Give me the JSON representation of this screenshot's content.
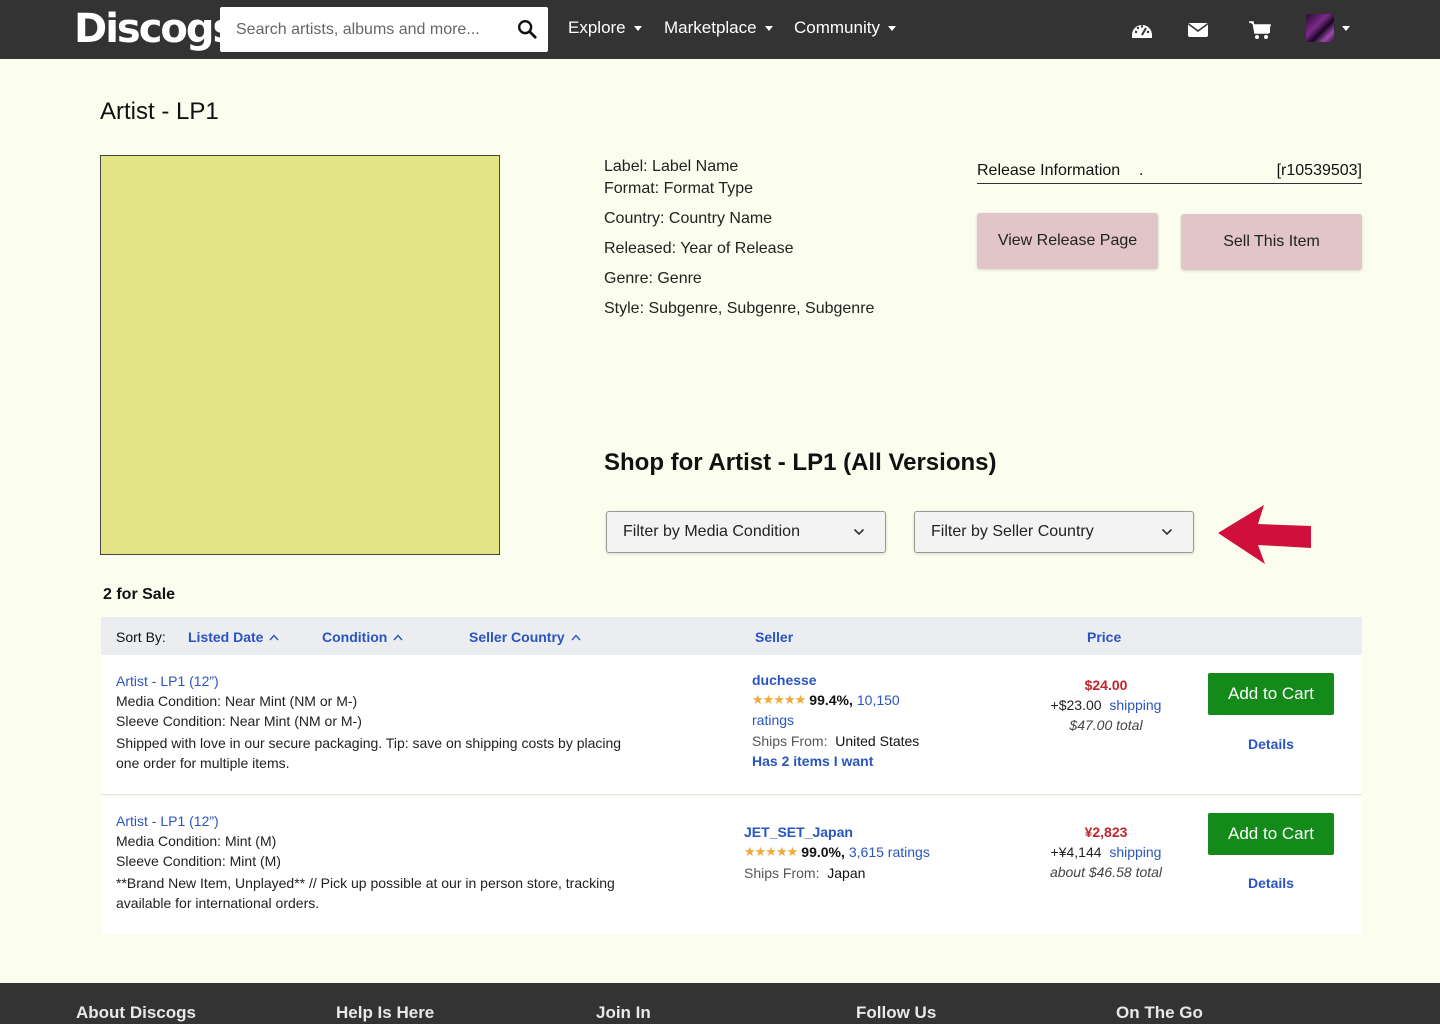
{
  "header": {
    "logo": "Discogs",
    "search_placeholder": "Search artists, albums and more...",
    "nav": [
      {
        "label": "Explore"
      },
      {
        "label": "Marketplace"
      },
      {
        "label": "Community"
      }
    ],
    "icons": [
      "dashboard-icon",
      "mail-icon",
      "cart-icon",
      "avatar"
    ]
  },
  "page": {
    "title": "Artist - LP1"
  },
  "release": {
    "label": "Label: Label Name",
    "format": "Format: Format Type",
    "country": "Country: Country Name",
    "released": "Released: Year of Release",
    "genre": "Genre: Genre",
    "style": "Style: Subgenre, Subgenre, Subgenre",
    "info_title": "Release Information",
    "info_dot": ".",
    "release_id": "[r10539503]",
    "view_button": "View Release Page",
    "sell_button": "Sell This Item"
  },
  "shop": {
    "title": "Shop for Artist - LP1 (All Versions)",
    "filter_media": "Filter by Media Condition",
    "filter_country": "Filter by Seller Country",
    "for_sale_count": "2 for Sale"
  },
  "sort_bar": {
    "sort_by": "Sort By:",
    "listed_date": "Listed Date",
    "condition": "Condition",
    "seller_country": "Seller Country",
    "seller": "Seller",
    "price": "Price"
  },
  "listings": [
    {
      "title": "Artist - LP1 (12”)",
      "media_label": "Media Condition: ",
      "media_value": "Near Mint (NM or M-)",
      "sleeve_label": "Sleeve Condition: ",
      "sleeve_value": "Near Mint (NM or M-)",
      "comment_line1": "Shipped with love in our secure packaging. Tip: save on shipping costs by placing",
      "comment_line2": "one order for multiple items.",
      "seller": "duchesse",
      "rating_pct": "99.4%,",
      "ratings_count_a": "10,150",
      "ratings_count_b": "ratings",
      "ships_from_label": "Ships From:",
      "ships_from": "United States",
      "has_items": "Has 2 items I want",
      "price": "$24.00",
      "shipping_amount": "+$23.00",
      "shipping_link": "shipping",
      "total": "$47.00 total",
      "add_to_cart": "Add to Cart",
      "details": "Details",
      "stars": 4.5
    },
    {
      "title": "Artist - LP1 (12”)",
      "media_label": "Media Condition: ",
      "media_value": "Mint (M)",
      "sleeve_label": "Sleeve Condition: ",
      "sleeve_value": "Mint (M)",
      "comment_line1": "**Brand New Item, Unplayed** // Pick up possible at our in person store, tracking",
      "comment_line2": "available for international orders.",
      "seller": "JET_SET_Japan",
      "rating_pct": "99.0%,",
      "ratings": "3,615 ratings",
      "ships_from_label": "Ships From:",
      "ships_from": "Japan",
      "price": "¥2,823",
      "shipping_amount": "+¥4,144",
      "shipping_link": "shipping",
      "total": "about $46.58 total",
      "add_to_cart": "Add to Cart",
      "details": "Details",
      "stars": 4.5
    }
  ],
  "footer": {
    "columns": [
      "About Discogs",
      "Help Is Here",
      "Join In",
      "Follow Us",
      "On The Go"
    ]
  },
  "colors": {
    "header_bg": "#333333",
    "page_bg": "#fbfdee",
    "cover": "#e3e585",
    "pink_button": "#e2c5c8",
    "link": "#2a55c0",
    "price_red": "#c0252c",
    "cart_green": "#138a19",
    "arrow_red": "#d0103a"
  }
}
